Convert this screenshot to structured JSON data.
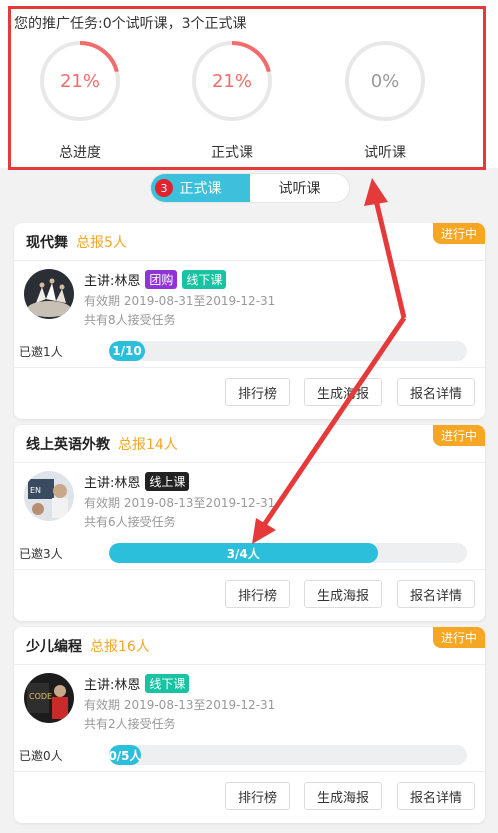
{
  "summary": {
    "title": "您的推广任务:0个试听课，3个正式课",
    "rings": [
      {
        "pct_text": "21%",
        "fraction": 0.21,
        "label": "总进度"
      },
      {
        "pct_text": "21%",
        "fraction": 0.21,
        "label": "正式课"
      },
      {
        "pct_text": "0%",
        "fraction": 0.0,
        "label": "试听课"
      }
    ]
  },
  "tabs": {
    "badge": "3",
    "formal": "正式课",
    "trial": "试听课"
  },
  "courses": [
    {
      "name": "现代舞",
      "total": "总报5人",
      "status": "进行中",
      "lecturer": "主讲:林恩",
      "tags": [
        "团购",
        "线下课"
      ],
      "validity": "有效期 2019-08-31至2019-12-31",
      "accepted": "共有8人接受任务",
      "invited": "已邀1人",
      "progress_text": "1/10",
      "progress_fraction": 0.1
    },
    {
      "name": "线上英语外教",
      "total": "总报14人",
      "status": "进行中",
      "lecturer": "主讲:林恩",
      "tags": [
        "线上课"
      ],
      "validity": "有效期 2019-08-13至2019-12-31",
      "accepted": "共有6人接受任务",
      "invited": "已邀3人",
      "progress_text": "3/4人",
      "progress_fraction": 0.75
    },
    {
      "name": "少儿编程",
      "total": "总报16人",
      "status": "进行中",
      "lecturer": "主讲:林恩",
      "tags": [
        "线下课"
      ],
      "validity": "有效期 2019-08-13至2019-12-31",
      "accepted": "共有2人接受任务",
      "invited": "已邀0人",
      "progress_text": "0/5人",
      "progress_fraction": 0.0
    }
  ],
  "buttons": {
    "ranking": "排行榜",
    "poster": "生成海报",
    "details": "报名详情"
  },
  "colors": {
    "accent": "#3cc0dc",
    "ring_progress": "#f26c6c",
    "annotation": "#e63a3a",
    "total_orange": "#f5a623"
  }
}
